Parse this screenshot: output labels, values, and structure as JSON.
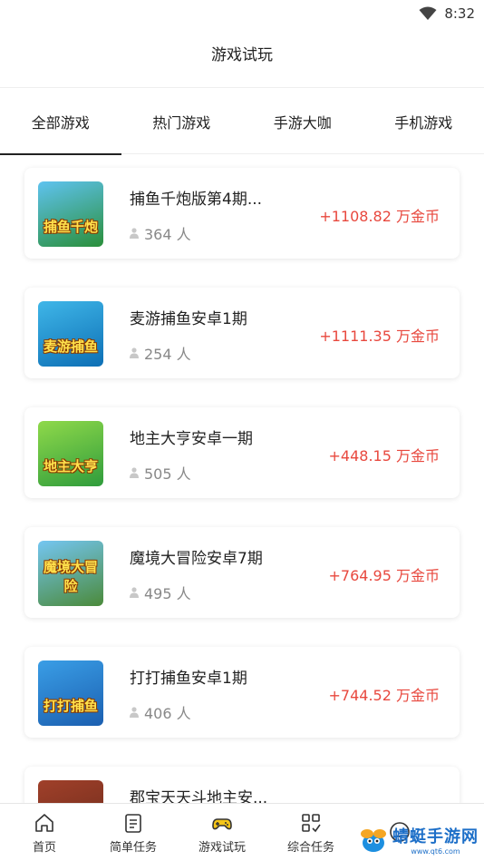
{
  "status": {
    "time": "8:32"
  },
  "header": {
    "title": "游戏试玩"
  },
  "tabs": [
    {
      "label": "全部游戏",
      "active": true
    },
    {
      "label": "热门游戏",
      "active": false
    },
    {
      "label": "手游大咖",
      "active": false
    },
    {
      "label": "手机游戏",
      "active": false
    }
  ],
  "games": [
    {
      "name": "捕鱼千炮版第4期...",
      "players": "364 人",
      "reward": "+1108.82 万金币",
      "thumb_text": "捕鱼千炮",
      "thumb_colors": [
        "#5fc3f0",
        "#2a8f3a"
      ]
    },
    {
      "name": "麦游捕鱼安卓1期",
      "players": "254 人",
      "reward": "+1111.35 万金币",
      "thumb_text": "麦游捕鱼",
      "thumb_colors": [
        "#3fb6e8",
        "#0d6fb5"
      ]
    },
    {
      "name": "地主大亨安卓一期",
      "players": "505 人",
      "reward": "+448.15 万金币",
      "thumb_text": "地主大亨",
      "thumb_colors": [
        "#8fd94a",
        "#2f9c3c"
      ]
    },
    {
      "name": "魔境大冒险安卓7期",
      "players": "495 人",
      "reward": "+764.95 万金币",
      "thumb_text": "魔境大冒险",
      "thumb_colors": [
        "#74c6f2",
        "#4b8a3a"
      ]
    },
    {
      "name": "打打捕鱼安卓1期",
      "players": "406 人",
      "reward": "+744.52 万金币",
      "thumb_text": "打打捕鱼",
      "thumb_colors": [
        "#3a9ee6",
        "#1b5fb0"
      ]
    },
    {
      "name": "郡宝天天斗地主安...",
      "players": "",
      "reward": "",
      "thumb_text": "",
      "thumb_colors": [
        "#a0402a",
        "#6a2a1a"
      ]
    }
  ],
  "bottom_nav": [
    {
      "label": "首页",
      "icon": "home-icon"
    },
    {
      "label": "简单任务",
      "icon": "clipboard-icon"
    },
    {
      "label": "游戏试玩",
      "icon": "gamepad-icon"
    },
    {
      "label": "综合任务",
      "icon": "grid-icon"
    },
    {
      "label": "",
      "icon": "face-icon"
    }
  ],
  "watermark": {
    "name": "蜻蜓手游网",
    "url": "www.qt6.com"
  },
  "colors": {
    "reward": "#e8483e",
    "accent": "#222222"
  }
}
